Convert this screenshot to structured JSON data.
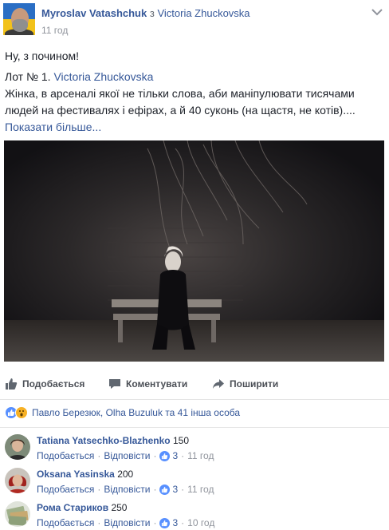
{
  "post": {
    "author": "Myroslav Vatashchuk",
    "with_word": "з",
    "co_author": "Victoria Zhuckovska",
    "timestamp": "11 год",
    "text_line1": "Ну, з почином!",
    "text_line2_prefix": "Лот № 1.",
    "text_line2_link": "Victoria Zhuckovska",
    "text_line3": "Жінка, в арсеналі якої не тільки слова, аби маніпулювати тисячами людей на фестивалях і ефірах, а й 40 суконь (на щастя, не котів)....",
    "see_more": "Показати більше..."
  },
  "actions": {
    "like": "Подобається",
    "comment": "Коментувати",
    "share": "Поширити"
  },
  "reactions": {
    "summary": "Павло Березюк, Olha Buzuluk та 41 інша особа",
    "icons": [
      "like-icon",
      "wow-icon"
    ]
  },
  "comments": [
    {
      "author": "Tatiana Yatsechko-Blazhenko",
      "text": "150",
      "like": "Подобається",
      "reply": "Відповісти",
      "likes": "3",
      "time": "11 год"
    },
    {
      "author": "Oksana Yasinska",
      "text": "200",
      "like": "Подобається",
      "reply": "Відповісти",
      "likes": "3",
      "time": "11 год"
    },
    {
      "author": "Рома Стариков",
      "text": "250",
      "like": "Подобається",
      "reply": "Відповісти",
      "likes": "3",
      "time": "10 год"
    }
  ],
  "colors": {
    "link": "#365899",
    "meta": "#90949c",
    "text": "#1d2129",
    "like_blue": "#5890ff",
    "wow_yellow": "#f7b125"
  }
}
